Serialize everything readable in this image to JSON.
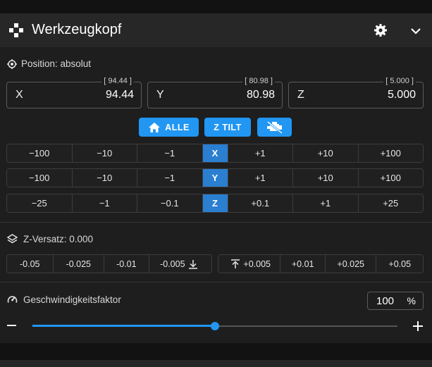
{
  "header": {
    "title": "Werkzeugkopf",
    "icon": "gamepad-dpad-icon",
    "settings_icon": "gear-icon",
    "collapse_icon": "chevron-down-icon"
  },
  "position": {
    "label": "Position: absolut",
    "fields": [
      {
        "axis": "X",
        "value": "94.44",
        "requested": "[ 94.44 ]"
      },
      {
        "axis": "Y",
        "value": "80.98",
        "requested": "[ 80.98 ]"
      },
      {
        "axis": "Z",
        "value": "5.000",
        "requested": "[ 5.000 ]"
      }
    ]
  },
  "actions": {
    "home_all": "ALLE",
    "z_tilt": "Z TILT",
    "motors_off_icon": "engine-off-icon"
  },
  "jog": {
    "x": {
      "axis": "X",
      "steps": [
        "−100",
        "−10",
        "−1",
        "+1",
        "+10",
        "+100"
      ]
    },
    "y": {
      "axis": "Y",
      "steps": [
        "−100",
        "−10",
        "−1",
        "+1",
        "+10",
        "+100"
      ]
    },
    "z": {
      "axis": "Z",
      "steps": [
        "−25",
        "−1",
        "−0.1",
        "+0.1",
        "+1",
        "+25"
      ]
    }
  },
  "z_offset": {
    "label": "Z-Versatz: 0.000",
    "down": [
      "-0.05",
      "-0.025",
      "-0.01",
      "-0.005"
    ],
    "up": [
      "+0.005",
      "+0.01",
      "+0.025",
      "+0.05"
    ]
  },
  "speed": {
    "label": "Geschwindigkeitsfaktor",
    "value": "100",
    "unit": "%",
    "slider_fraction": 0.5
  },
  "colors": {
    "accent": "#2196f3",
    "axis_cell": "#2b7fd1",
    "panel": "#1e1e1e",
    "header": "#272727"
  }
}
